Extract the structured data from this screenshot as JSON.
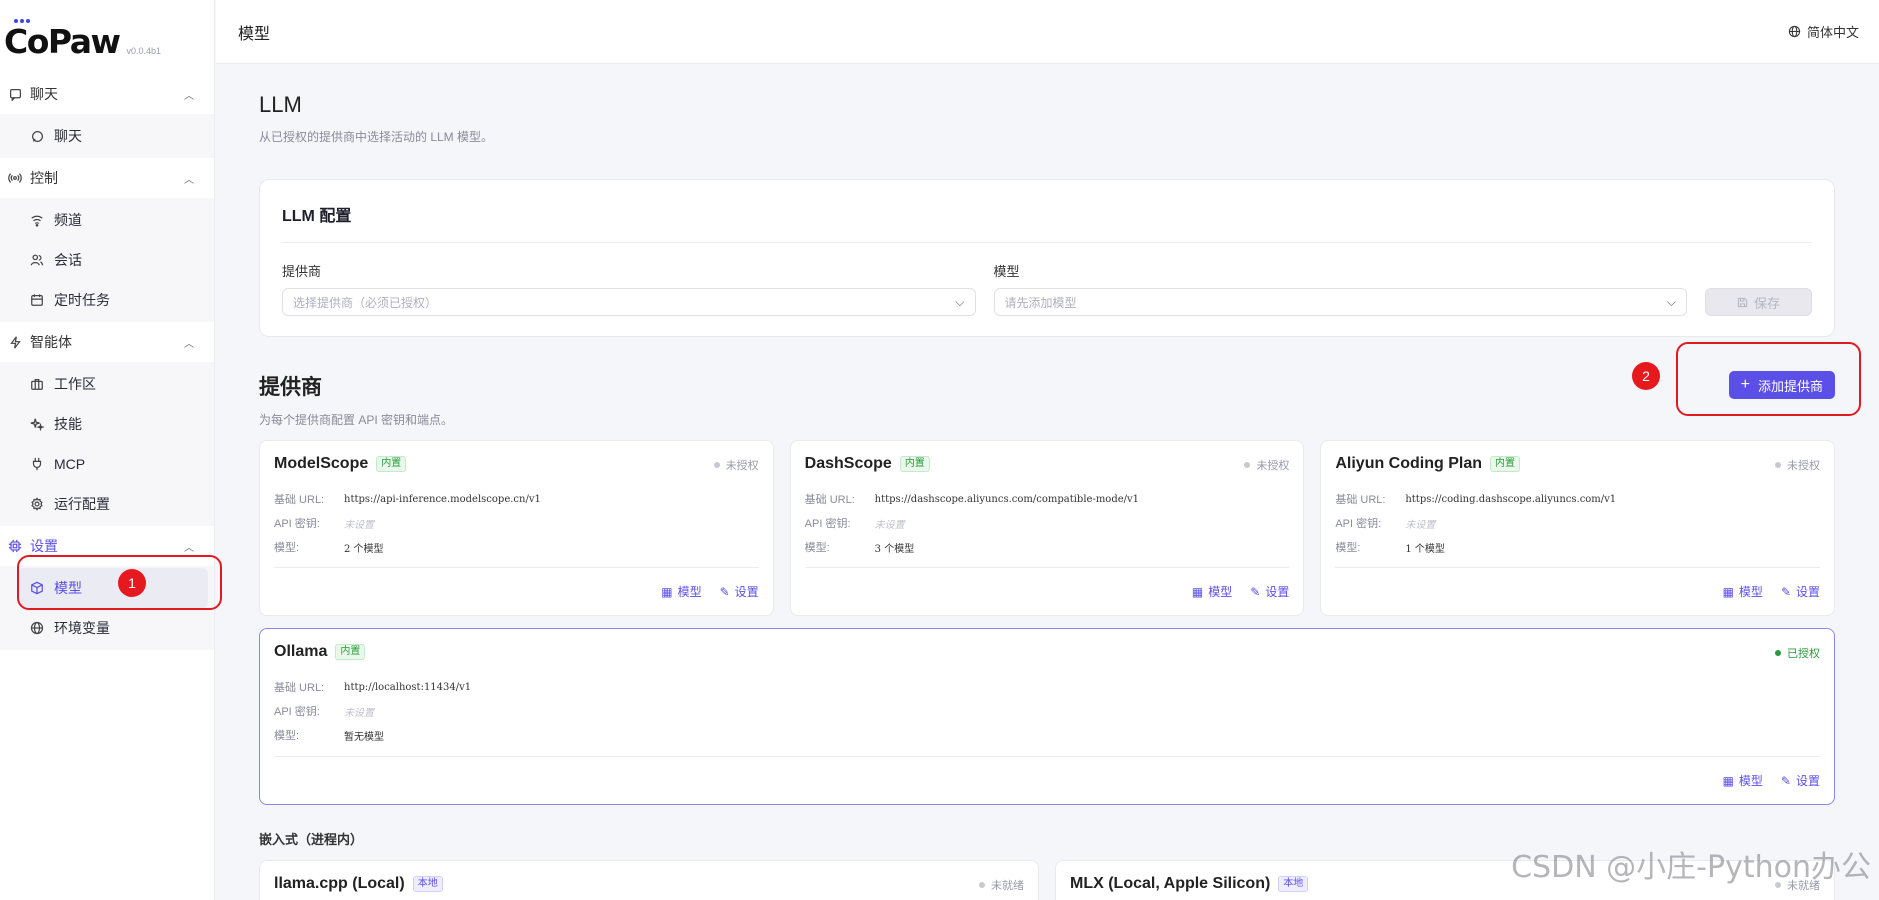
{
  "app": {
    "logo": "CoPaw",
    "version": "v0.0.4b1"
  },
  "sidebar": {
    "groups": [
      {
        "label": "聊天",
        "icon": "chat-bubble-icon",
        "items": [
          {
            "label": "聊天",
            "icon": "chat-bubble-icon"
          }
        ]
      },
      {
        "label": "控制",
        "icon": "broadcast-icon",
        "items": [
          {
            "label": "频道",
            "icon": "wifi-icon"
          },
          {
            "label": "会话",
            "icon": "users-icon"
          },
          {
            "label": "定时任务",
            "icon": "calendar-icon"
          }
        ]
      },
      {
        "label": "智能体",
        "icon": "lightning-icon",
        "items": [
          {
            "label": "工作区",
            "icon": "briefcase-icon"
          },
          {
            "label": "技能",
            "icon": "sparkle-icon"
          },
          {
            "label": "MCP",
            "icon": "plug-icon"
          },
          {
            "label": "运行配置",
            "icon": "gear-icon"
          }
        ]
      },
      {
        "label": "设置",
        "icon": "chip-icon",
        "items": [
          {
            "label": "模型",
            "icon": "cube-icon"
          },
          {
            "label": "环境变量",
            "icon": "globe-icon"
          }
        ]
      }
    ]
  },
  "annotations": {
    "one": "1",
    "two": "2"
  },
  "topbar": {
    "title": "模型",
    "language": "简体中文"
  },
  "llm": {
    "title": "LLM",
    "subtitle": "从已授权的提供商中选择活动的 LLM 模型。",
    "config_title": "LLM 配置",
    "provider_label": "提供商",
    "provider_placeholder": "选择提供商（必须已授权）",
    "model_label": "模型",
    "model_placeholder": "请先添加模型",
    "save_label": "保存"
  },
  "providers": {
    "title": "提供商",
    "subtitle": "为每个提供商配置 API 密钥和端点。",
    "add_label": "添加提供商",
    "labels": {
      "url": "基础 URL:",
      "key": "API 密钥:",
      "models": "模型:",
      "models_btn": "模型",
      "settings_btn": "设置"
    },
    "cards": [
      {
        "name": "ModelScope",
        "tag": "内置",
        "status": "未授权",
        "url": "https://api-inference.modelscope.cn/v1",
        "key": "未设置",
        "models": "2 个模型"
      },
      {
        "name": "DashScope",
        "tag": "内置",
        "status": "未授权",
        "url": "https://dashscope.aliyuncs.com/compatible-mode/v1",
        "key": "未设置",
        "models": "3 个模型"
      },
      {
        "name": "Aliyun Coding Plan",
        "tag": "内置",
        "status": "未授权",
        "url": "https://coding.dashscope.aliyuncs.com/v1",
        "key": "未设置",
        "models": "1 个模型"
      },
      {
        "name": "Ollama",
        "tag": "内置",
        "status": "已授权",
        "url": "http://localhost:11434/v1",
        "key": "未设置",
        "models": "暂无模型"
      }
    ],
    "embedded_label": "嵌入式（进程内）",
    "embedded": [
      {
        "name": "llama.cpp (Local)",
        "tag": "本地",
        "status": "未就绪"
      },
      {
        "name": "MLX (Local, Apple Silicon)",
        "tag": "本地",
        "status": "未就绪"
      }
    ]
  },
  "watermark": "CSDN @小庄-Python办公"
}
